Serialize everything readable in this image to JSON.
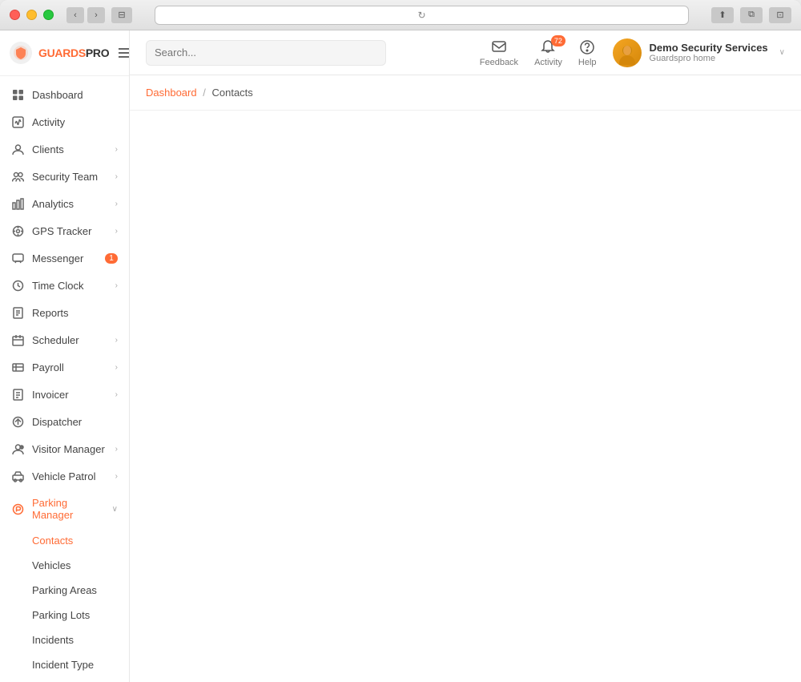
{
  "window": {
    "title": "GuardsPro",
    "url_placeholder": "reload"
  },
  "logo": {
    "text_guards": "GUARDS",
    "text_pro": "PRO"
  },
  "search": {
    "placeholder": "Search..."
  },
  "header": {
    "feedback_label": "Feedback",
    "activity_label": "Activity",
    "help_label": "Help",
    "activity_badge": "72",
    "user_name": "Demo Security Services",
    "user_org": "Guardspro home"
  },
  "breadcrumb": {
    "parent": "Dashboard",
    "separator": "/",
    "current": "Contacts"
  },
  "sidebar": {
    "items": [
      {
        "id": "dashboard",
        "label": "Dashboard",
        "icon": "grid-icon",
        "has_arrow": false,
        "has_badge": false,
        "active": false
      },
      {
        "id": "activity",
        "label": "Activity",
        "icon": "activity-icon",
        "has_arrow": false,
        "has_badge": false,
        "active": false
      },
      {
        "id": "clients",
        "label": "Clients",
        "icon": "clients-icon",
        "has_arrow": true,
        "has_badge": false,
        "active": false
      },
      {
        "id": "security-team",
        "label": "Security Team",
        "icon": "team-icon",
        "has_arrow": true,
        "has_badge": false,
        "active": false
      },
      {
        "id": "analytics",
        "label": "Analytics",
        "icon": "analytics-icon",
        "has_arrow": true,
        "has_badge": false,
        "active": false
      },
      {
        "id": "gps-tracker",
        "label": "GPS Tracker",
        "icon": "gps-icon",
        "has_arrow": true,
        "has_badge": false,
        "active": false
      },
      {
        "id": "messenger",
        "label": "Messenger",
        "icon": "messenger-icon",
        "has_arrow": false,
        "has_badge": true,
        "badge_value": "1",
        "active": false
      },
      {
        "id": "time-clock",
        "label": "Time Clock",
        "icon": "clock-icon",
        "has_arrow": true,
        "has_badge": false,
        "active": false
      },
      {
        "id": "reports",
        "label": "Reports",
        "icon": "reports-icon",
        "has_arrow": false,
        "has_badge": false,
        "active": false
      },
      {
        "id": "scheduler",
        "label": "Scheduler",
        "icon": "scheduler-icon",
        "has_arrow": true,
        "has_badge": false,
        "active": false
      },
      {
        "id": "payroll",
        "label": "Payroll",
        "icon": "payroll-icon",
        "has_arrow": true,
        "has_badge": false,
        "active": false
      },
      {
        "id": "invoicer",
        "label": "Invoicer",
        "icon": "invoicer-icon",
        "has_arrow": true,
        "has_badge": false,
        "active": false
      },
      {
        "id": "dispatcher",
        "label": "Dispatcher",
        "icon": "dispatcher-icon",
        "has_arrow": false,
        "has_badge": false,
        "active": false
      },
      {
        "id": "visitor-manager",
        "label": "Visitor Manager",
        "icon": "visitor-icon",
        "has_arrow": true,
        "has_badge": false,
        "active": false
      },
      {
        "id": "vehicle-patrol",
        "label": "Vehicle Patrol",
        "icon": "vehicle-icon",
        "has_arrow": true,
        "has_badge": false,
        "active": false
      },
      {
        "id": "parking-manager",
        "label": "Parking Manager",
        "icon": "parking-icon",
        "has_arrow": false,
        "has_badge": false,
        "active": true,
        "expanded": true
      }
    ],
    "sub_items": [
      {
        "id": "contacts",
        "label": "Contacts",
        "active": true
      },
      {
        "id": "vehicles",
        "label": "Vehicles",
        "active": false
      },
      {
        "id": "parking-areas",
        "label": "Parking Areas",
        "active": false
      },
      {
        "id": "parking-lots",
        "label": "Parking Lots",
        "active": false
      },
      {
        "id": "incidents",
        "label": "Incidents",
        "active": false
      },
      {
        "id": "incident-type",
        "label": "Incident Type",
        "active": false
      }
    ]
  }
}
